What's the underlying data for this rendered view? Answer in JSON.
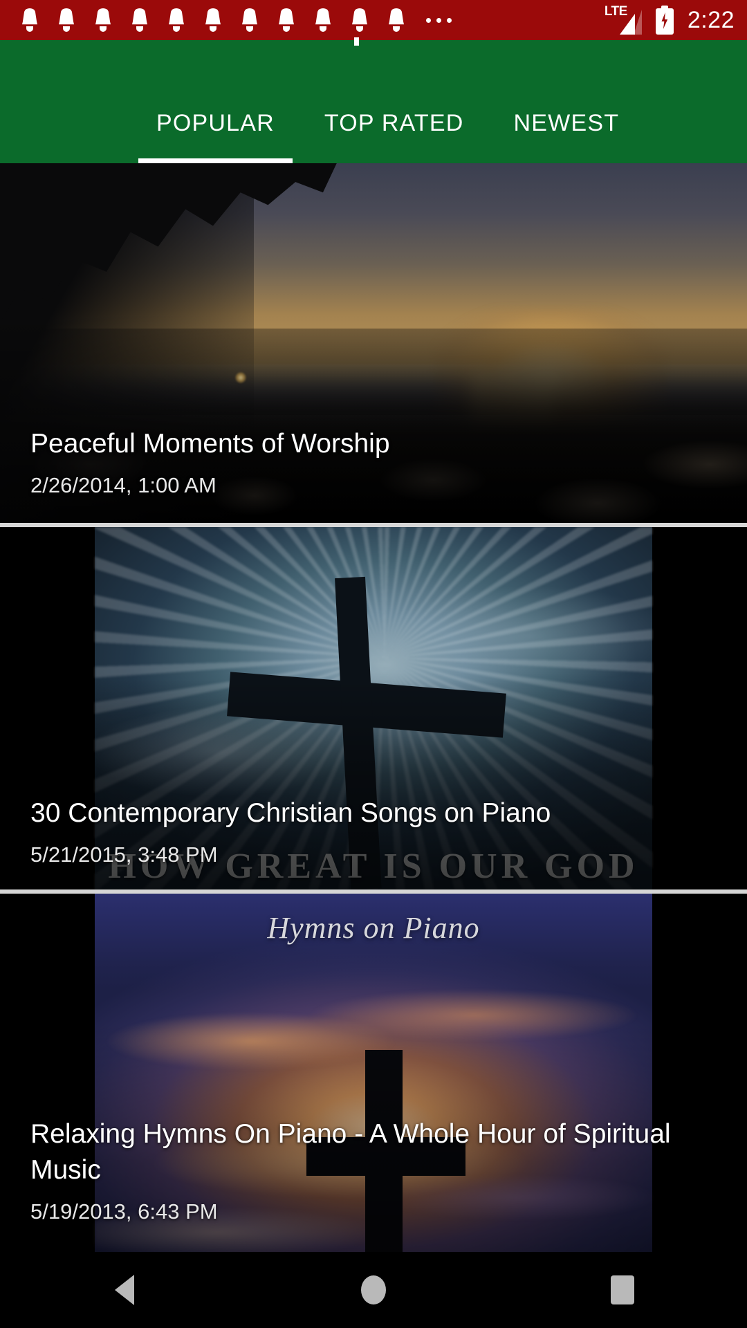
{
  "status_bar": {
    "notification_icon": "bell-icon",
    "notification_count": 11,
    "overflow_label": "",
    "network_type": "LTE",
    "battery_state": "charging",
    "time": "2:22",
    "background_color": "#9B0A0A"
  },
  "tab_bar": {
    "background_color": "#0B6B2B",
    "active_index": 0,
    "tabs": [
      {
        "label": "POPULAR"
      },
      {
        "label": "TOP RATED"
      },
      {
        "label": "NEWEST"
      }
    ]
  },
  "list": {
    "items": [
      {
        "title": "Peaceful Moments of Worship",
        "date": "2/26/2014, 1:00 AM",
        "thumbnail": "sunset-shoreline-thumbnail"
      },
      {
        "title": "30 Contemporary Christian Songs on Piano",
        "date": "5/21/2015, 3:48 PM",
        "thumbnail": "cross-silhouette-thumbnail",
        "thumbnail_overlay_text": "HOW GREAT IS OUR GOD"
      },
      {
        "title": "Relaxing Hymns On Piano - A Whole Hour of Spiritual Music",
        "date": "5/19/2013, 6:43 PM",
        "thumbnail": "hymns-on-piano-thumbnail",
        "thumbnail_overlay_text": "Hymns on Piano"
      }
    ]
  },
  "nav_bar": {
    "back_label": "Back",
    "home_label": "Home",
    "recents_label": "Recents"
  }
}
